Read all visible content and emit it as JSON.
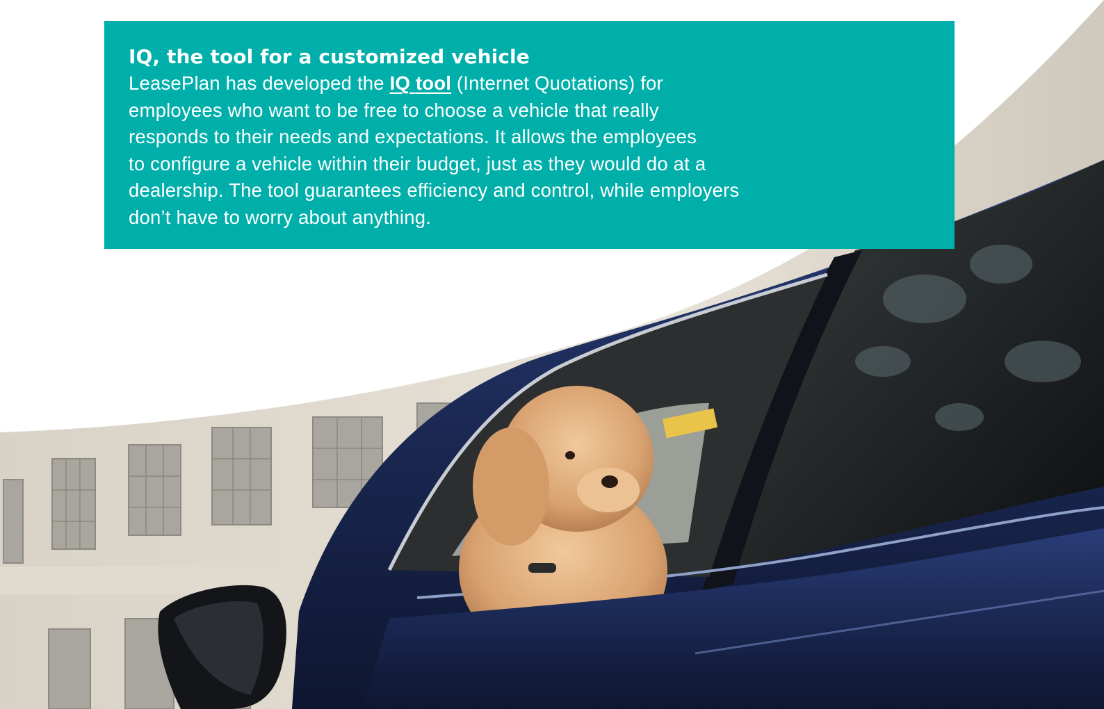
{
  "info_box": {
    "title": "IQ, the tool for a customized vehicle",
    "body_prefix": "LeasePlan has developed the ",
    "link_text": "IQ tool",
    "body_line1_suffix": " (Internet Quotations) for",
    "body_line2": "employees who want to be free to choose a vehicle that really",
    "body_line3": "responds to their needs and expectations. It allows the employees",
    "body_line4": "to configure a vehicle within their budget, just as they would do at a",
    "body_line5": "dealership. The tool guarantees efficiency and control, while employers",
    "body_line6": "don’t have to worry about anything."
  },
  "colors": {
    "box_background": "#00afaa",
    "text": "#ffffff",
    "car_paint": "#1b2a55"
  },
  "photo": {
    "subject": "poodle-in-car-window-photo"
  }
}
